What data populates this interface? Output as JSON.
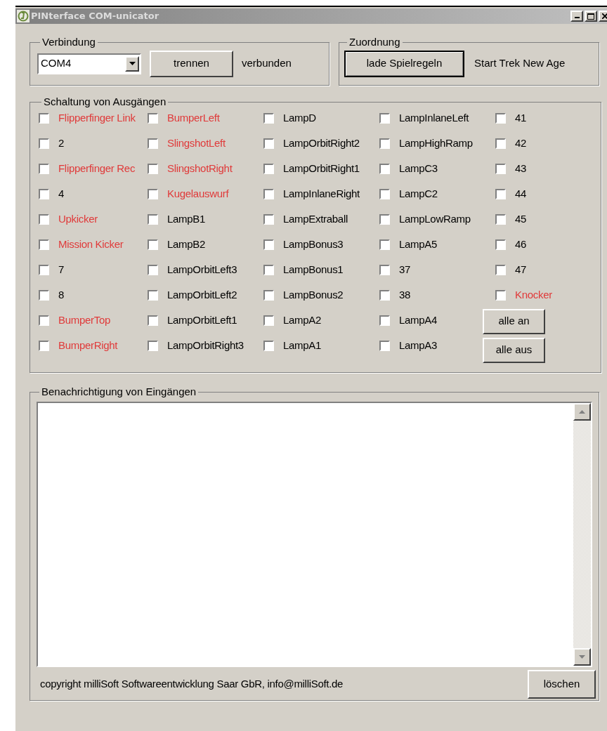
{
  "window": {
    "title": "PINterface COM-unicator"
  },
  "connection": {
    "legend": "Verbindung",
    "port": "COM4",
    "button": "trennen",
    "status": "verbunden"
  },
  "assignment": {
    "legend": "Zuordnung",
    "button": "lade Spielregeln",
    "game": "Start Trek New Age"
  },
  "outputs": {
    "legend": "Schaltung von Ausgängen",
    "columns": [
      [
        {
          "label": "Flipperfinger Link",
          "checked": false,
          "color": "#e03a3a"
        },
        {
          "label": "2",
          "checked": false,
          "color": "#000000"
        },
        {
          "label": "Flipperfinger Rec",
          "checked": false,
          "color": "#e03a3a"
        },
        {
          "label": "4",
          "checked": false,
          "color": "#000000"
        },
        {
          "label": "Upkicker",
          "checked": false,
          "color": "#e03a3a"
        },
        {
          "label": "Mission Kicker",
          "checked": false,
          "color": "#e03a3a"
        },
        {
          "label": "7",
          "checked": false,
          "color": "#000000"
        },
        {
          "label": "8",
          "checked": false,
          "color": "#000000"
        },
        {
          "label": "BumperTop",
          "checked": false,
          "color": "#e03a3a"
        },
        {
          "label": "BumperRight",
          "checked": false,
          "color": "#e03a3a"
        }
      ],
      [
        {
          "label": "BumperLeft",
          "checked": false,
          "color": "#e03a3a"
        },
        {
          "label": "SlingshotLeft",
          "checked": false,
          "color": "#e03a3a"
        },
        {
          "label": "SlingshotRight",
          "checked": false,
          "color": "#e03a3a"
        },
        {
          "label": "Kugelauswurf",
          "checked": false,
          "color": "#e03a3a"
        },
        {
          "label": "LampB1",
          "checked": false,
          "color": "#000000"
        },
        {
          "label": "LampB2",
          "checked": false,
          "color": "#000000"
        },
        {
          "label": "LampOrbitLeft3",
          "checked": false,
          "color": "#000000"
        },
        {
          "label": "LampOrbitLeft2",
          "checked": false,
          "color": "#000000"
        },
        {
          "label": "LampOrbitLeft1",
          "checked": false,
          "color": "#000000"
        },
        {
          "label": "LampOrbitRight3",
          "checked": false,
          "color": "#000000"
        }
      ],
      [
        {
          "label": "LampD",
          "checked": false,
          "color": "#000000"
        },
        {
          "label": "LampOrbitRight2",
          "checked": false,
          "color": "#000000"
        },
        {
          "label": "LampOrbitRight1",
          "checked": false,
          "color": "#000000"
        },
        {
          "label": "LampInlaneRight",
          "checked": false,
          "color": "#000000"
        },
        {
          "label": "LampExtraball",
          "checked": false,
          "color": "#000000"
        },
        {
          "label": "LampBonus3",
          "checked": false,
          "color": "#000000"
        },
        {
          "label": "LampBonus1",
          "checked": false,
          "color": "#000000"
        },
        {
          "label": "LampBonus2",
          "checked": false,
          "color": "#000000"
        },
        {
          "label": "LampA2",
          "checked": false,
          "color": "#000000"
        },
        {
          "label": "LampA1",
          "checked": false,
          "color": "#000000"
        }
      ],
      [
        {
          "label": "LampInlaneLeft",
          "checked": false,
          "color": "#000000"
        },
        {
          "label": "LampHighRamp",
          "checked": false,
          "color": "#000000"
        },
        {
          "label": "LampC3",
          "checked": false,
          "color": "#000000"
        },
        {
          "label": "LampC2",
          "checked": false,
          "color": "#000000"
        },
        {
          "label": "LampLowRamp",
          "checked": false,
          "color": "#000000"
        },
        {
          "label": "LampA5",
          "checked": false,
          "color": "#000000"
        },
        {
          "label": "37",
          "checked": false,
          "color": "#000000"
        },
        {
          "label": "38",
          "checked": false,
          "color": "#000000"
        },
        {
          "label": "LampA4",
          "checked": false,
          "color": "#000000"
        },
        {
          "label": "LampA3",
          "checked": false,
          "color": "#000000"
        }
      ],
      [
        {
          "label": "41",
          "checked": false,
          "color": "#000000"
        },
        {
          "label": "42",
          "checked": false,
          "color": "#000000"
        },
        {
          "label": "43",
          "checked": false,
          "color": "#000000"
        },
        {
          "label": "44",
          "checked": false,
          "color": "#000000"
        },
        {
          "label": "45",
          "checked": false,
          "color": "#000000"
        },
        {
          "label": "46",
          "checked": false,
          "color": "#000000"
        },
        {
          "label": "47",
          "checked": false,
          "color": "#000000"
        },
        {
          "label": "Knocker",
          "checked": false,
          "color": "#e03a3a"
        }
      ]
    ],
    "buttons": [
      "alle an",
      "alle aus"
    ]
  },
  "inputs": {
    "legend": "Benachrichtigung von Eingängen",
    "copyright": "copyright milliSoft Softwareentwicklung Saar GbR, info@milliSoft.de",
    "button": "löschen"
  }
}
